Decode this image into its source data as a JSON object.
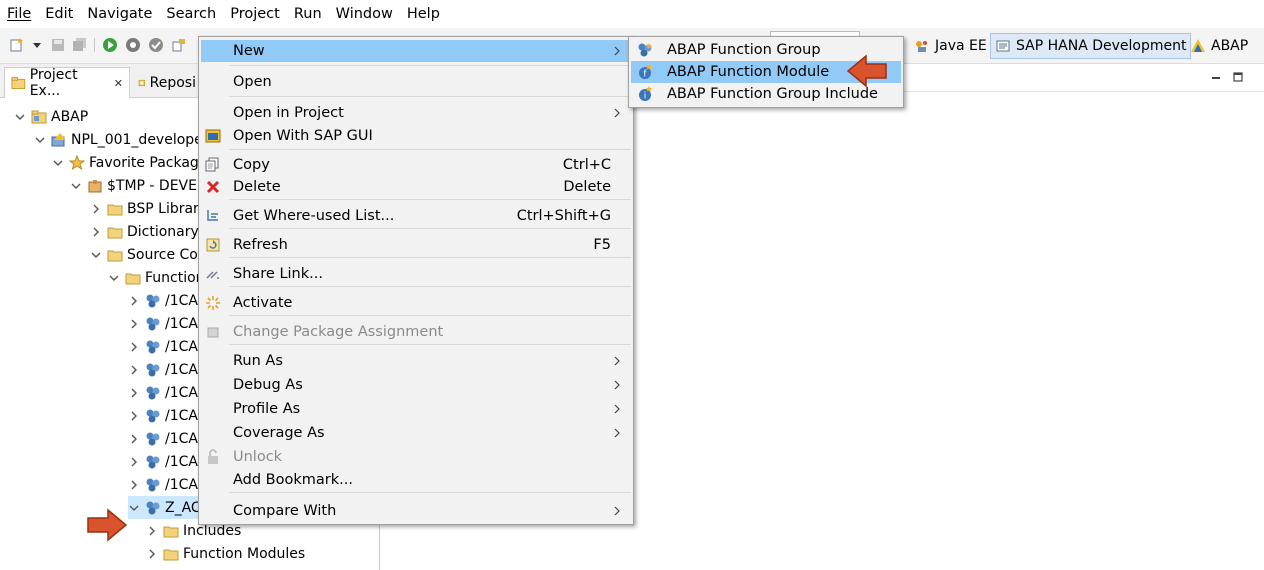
{
  "menubar": [
    "File",
    "Edit",
    "Navigate",
    "Search",
    "Project",
    "Run",
    "Window",
    "Help"
  ],
  "perspectives": [
    {
      "label": "Java EE",
      "active": false
    },
    {
      "label": "SAP HANA Development",
      "active": true
    },
    {
      "label": "ABAP",
      "active": false
    }
  ],
  "left_tabs": [
    {
      "label": "Project Ex...",
      "close": "✕"
    },
    {
      "label": "Reposi"
    }
  ],
  "tree": [
    {
      "label": "ABAP",
      "expanded": true,
      "icon": "project-folder-icon"
    },
    {
      "label": "NPL_001_developer",
      "expanded": true,
      "icon": "abap-project-icon"
    },
    {
      "label": "Favorite Package",
      "expanded": true,
      "icon": "star-icon"
    },
    {
      "label": "$TMP - DEVEL",
      "expanded": true,
      "icon": "package-icon"
    },
    {
      "label": "BSP Library",
      "expanded": false,
      "icon": "folder-icon"
    },
    {
      "label": "Dictionary",
      "expanded": false,
      "icon": "folder-icon"
    },
    {
      "label": "Source Coc",
      "expanded": true,
      "icon": "folder-icon"
    },
    {
      "label": "Function",
      "expanded": true,
      "icon": "folder-icon"
    },
    {
      "label": "/1CA",
      "expanded": false,
      "icon": "function-group-icon"
    },
    {
      "label": "/1CA",
      "expanded": false,
      "icon": "function-group-icon"
    },
    {
      "label": "/1CA",
      "expanded": false,
      "icon": "function-group-icon"
    },
    {
      "label": "/1CA",
      "expanded": false,
      "icon": "function-group-icon"
    },
    {
      "label": "/1CA",
      "expanded": false,
      "icon": "function-group-icon"
    },
    {
      "label": "/1CA",
      "expanded": false,
      "icon": "function-group-icon"
    },
    {
      "label": "/1CA",
      "expanded": false,
      "icon": "function-group-icon"
    },
    {
      "label": "/1CA",
      "expanded": false,
      "icon": "function-group-icon"
    },
    {
      "label": "/1CA",
      "expanded": false,
      "icon": "function-group-icon"
    },
    {
      "label": "Z_ACME",
      "expanded": true,
      "selected": true,
      "icon": "function-group-icon"
    },
    {
      "label": "Includes",
      "expanded": false,
      "icon": "folder-icon"
    },
    {
      "label": "Function Modules",
      "expanded": false,
      "icon": "folder-icon"
    }
  ],
  "context_menu": {
    "items": [
      {
        "label": "New",
        "submenu": true,
        "highlighted": true
      },
      {
        "label": "Open",
        "icon": "none"
      },
      {
        "label": "Open in Project",
        "submenu": true
      },
      {
        "label": "Open With SAP GUI",
        "icon": "sap-gui-icon"
      },
      {
        "label": "Copy",
        "shortcut": "Ctrl+C",
        "icon": "copy-icon"
      },
      {
        "label": "Delete",
        "shortcut": "Delete",
        "icon": "delete-icon"
      },
      {
        "label": "Get Where-used List...",
        "shortcut": "Ctrl+Shift+G",
        "icon": "where-used-icon"
      },
      {
        "label": "Refresh",
        "shortcut": "F5",
        "icon": "refresh-icon"
      },
      {
        "label": "Share Link...",
        "icon": "share-link-icon"
      },
      {
        "label": "Activate",
        "icon": "activate-icon"
      },
      {
        "label": "Change Package Assignment",
        "disabled": true,
        "icon": "change-package-icon"
      },
      {
        "label": "Run As",
        "submenu": true
      },
      {
        "label": "Debug As",
        "submenu": true
      },
      {
        "label": "Profile As",
        "submenu": true
      },
      {
        "label": "Coverage As",
        "submenu": true
      },
      {
        "label": "Unlock",
        "disabled": true,
        "icon": "unlock-icon"
      },
      {
        "label": "Add Bookmark...",
        "icon": "none"
      },
      {
        "label": "Compare With",
        "submenu": true
      }
    ]
  },
  "submenu_new": {
    "items": [
      {
        "label": "ABAP Function Group",
        "icon": "function-group-icon"
      },
      {
        "label": "ABAP Function Module",
        "icon": "function-module-icon",
        "highlighted": true
      },
      {
        "label": "ABAP Function Group Include",
        "icon": "function-group-include-icon"
      }
    ]
  },
  "colors": {
    "highlight": "#91c9f7",
    "arrow": "#e0502a",
    "selection": "#cce8ff"
  }
}
